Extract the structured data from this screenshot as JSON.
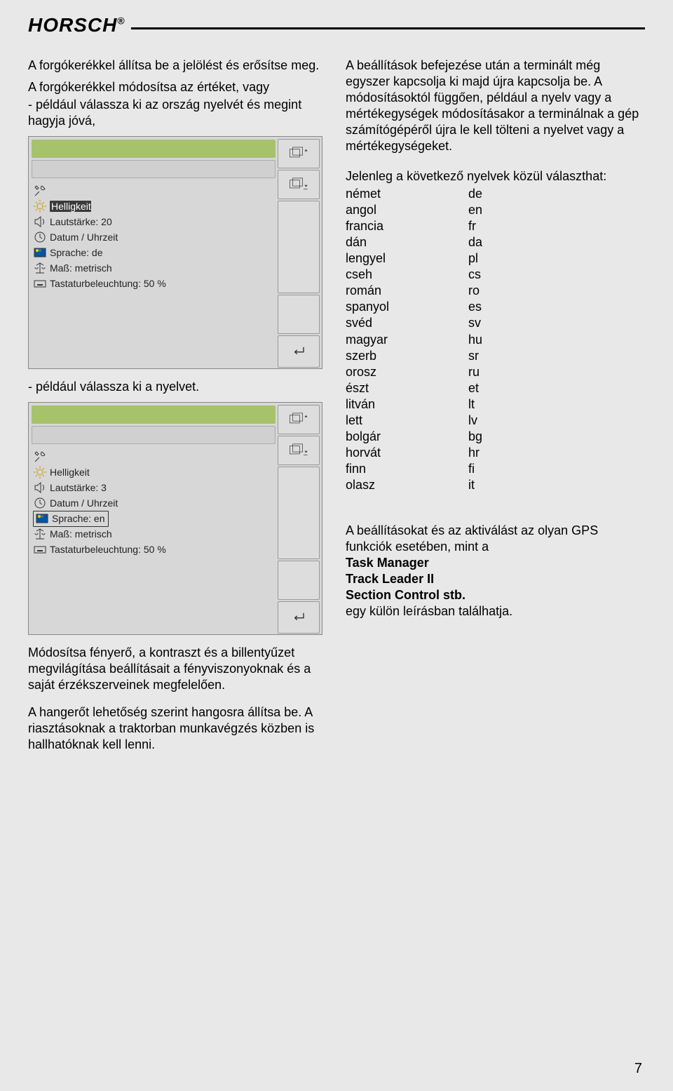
{
  "brand": "HORSCH",
  "brand_mark": "®",
  "left": {
    "p1": "A forgókerékkel állítsa be a jelölést és erősítse meg.",
    "p2": "A forgókerékkel módosítsa az értéket, vagy",
    "p3": "- például válassza ki az ország nyelvét és megint hagyja jóvá,",
    "caption1": "- például válassza ki a nyelvet.",
    "p4": "Módosítsa fényerő, a kontraszt és a billentyűzet megvilágítása beállításait a fényviszonyoknak és a saját érzékszerveinek megfelelően.",
    "p5": "A hangerőt lehetőség szerint hangosra állítsa be. A riasztásoknak a traktorban munkavégzés közben is hallhatóknak kell lenni."
  },
  "terminal1": {
    "rows": [
      {
        "icon": "tools",
        "label": ""
      },
      {
        "icon": "sun",
        "label": "Helligkeit",
        "highlight": true
      },
      {
        "icon": "speaker",
        "label": "Lautstärke: 20"
      },
      {
        "icon": "clock",
        "label": "Datum / Uhrzeit"
      },
      {
        "icon": "flag",
        "label": "Sprache: de"
      },
      {
        "icon": "scale",
        "label": "Maß: metrisch"
      },
      {
        "icon": "keyboard",
        "label": "Tastaturbeleuchtung:  50 %"
      }
    ]
  },
  "terminal2": {
    "rows": [
      {
        "icon": "tools",
        "label": ""
      },
      {
        "icon": "sun",
        "label": "Helligkeit"
      },
      {
        "icon": "speaker",
        "label": "Lautstärke: 3"
      },
      {
        "icon": "clock",
        "label": "Datum / Uhrzeit"
      },
      {
        "icon": "flag",
        "label": "Sprache: en",
        "outline": true
      },
      {
        "icon": "scale",
        "label": "Maß: metrisch"
      },
      {
        "icon": "keyboard",
        "label": "Tastaturbeleuchtung:  50 %"
      }
    ]
  },
  "right": {
    "p1": "A beállítások befejezése után a terminált még egyszer kapcsolja ki majd újra kapcsolja be. A módosításoktól függően, például a nyelv vagy a mértékegységek módosításakor a terminálnak a gép számítógépéről újra le kell tölteni a nyelvet vagy a mértékegységeket.",
    "lang_intro": "Jelenleg a következő nyelvek közül választhat:",
    "languages": [
      [
        "német",
        "de"
      ],
      [
        "angol",
        "en"
      ],
      [
        "francia",
        "fr"
      ],
      [
        "dán",
        "da"
      ],
      [
        "lengyel",
        "pl"
      ],
      [
        "cseh",
        "cs"
      ],
      [
        "román",
        "ro"
      ],
      [
        "spanyol",
        "es"
      ],
      [
        "svéd",
        "sv"
      ],
      [
        "magyar",
        "hu"
      ],
      [
        "szerb",
        "sr"
      ],
      [
        "orosz",
        "ru"
      ],
      [
        "észt",
        "et"
      ],
      [
        "litván",
        "lt"
      ],
      [
        "lett",
        "lv"
      ],
      [
        "bolgár",
        "bg"
      ],
      [
        "horvát",
        "hr"
      ],
      [
        "finn",
        "fi"
      ],
      [
        "olasz",
        "it"
      ]
    ],
    "gps1": "A beállításokat és az aktiválást az olyan GPS funkciók esetében, mint a",
    "gps_items": [
      "Task Manager",
      "Track Leader II",
      "Section Control stb."
    ],
    "gps2": "egy külön leírásban találhatja."
  },
  "page_num": "7"
}
